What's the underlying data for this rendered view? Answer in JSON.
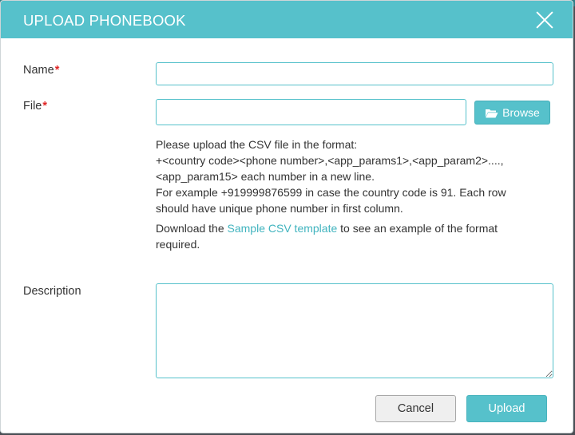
{
  "dialog": {
    "title": "UPLOAD PHONEBOOK",
    "close_icon": "close-icon"
  },
  "form": {
    "name": {
      "label": "Name",
      "required_marker": "*",
      "value": ""
    },
    "file": {
      "label": "File",
      "required_marker": "*",
      "value": "",
      "browse_label": "Browse",
      "browse_icon": "folder-open-icon"
    },
    "help": {
      "line1": "Please upload the CSV file in the format:",
      "line2": "+<country code><phone number>,<app_params1>,<app_param2>....,",
      "line3": "<app_param15> each number in a new line.",
      "line4": "For example +919999876599 in case the country code is 91. Each row should have unique phone number in first column.",
      "download_prefix": "Download the ",
      "download_link": "Sample CSV template",
      "download_suffix": " to see an example of the format required."
    },
    "description": {
      "label": "Description",
      "value": ""
    }
  },
  "footer": {
    "cancel_label": "Cancel",
    "upload_label": "Upload"
  },
  "colors": {
    "accent": "#56c1cb",
    "required": "#e02626",
    "link": "#41b4bf"
  }
}
